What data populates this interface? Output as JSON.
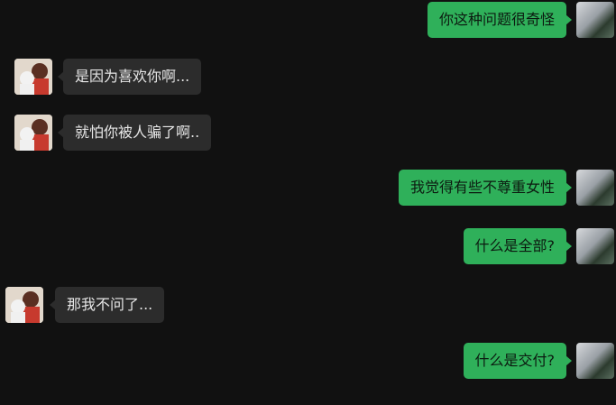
{
  "messages": [
    {
      "side": "right",
      "text": "你这种问题很奇怪"
    },
    {
      "side": "left",
      "text": "是因为喜欢你啊..."
    },
    {
      "side": "left",
      "text": "就怕你被人骗了啊.."
    },
    {
      "side": "right",
      "text": "我觉得有些不尊重女性"
    },
    {
      "side": "right",
      "text": "什么是全部?"
    },
    {
      "side": "left",
      "text": "那我不问了..."
    },
    {
      "side": "right",
      "text": "什么是交付?"
    }
  ],
  "avatars": {
    "self": "landscape-avatar",
    "other": "cartoon-couple-avatar"
  },
  "colors": {
    "background": "#111111",
    "self_bubble": "#2fb05a",
    "other_bubble": "#2c2c2c"
  }
}
